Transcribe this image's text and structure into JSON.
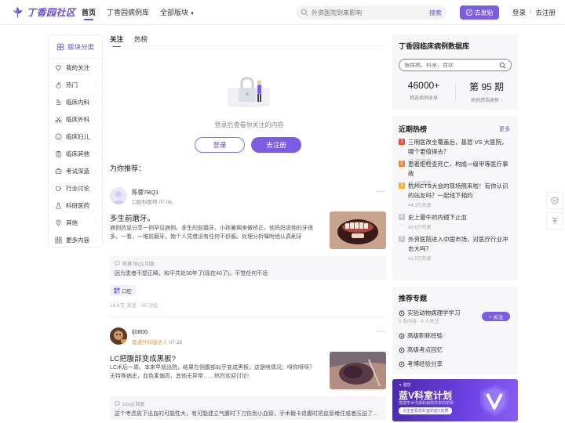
{
  "brand": {
    "logo_text": "丁香园社区",
    "accent": "#7c5ce0"
  },
  "nav": {
    "items": [
      "首页",
      "丁香园病例库",
      "全部版块"
    ]
  },
  "search": {
    "placeholder": "外资医院到来影响",
    "button": "搜索"
  },
  "header": {
    "post_label": "去发贴",
    "login": "登录",
    "sep": "/",
    "register": "去注册"
  },
  "sidebar": {
    "title": "版块分类",
    "items": [
      {
        "label": "我的关注",
        "icon": "heart-icon"
      },
      {
        "label": "热门",
        "icon": "fire-icon"
      },
      {
        "label": "临床内科",
        "icon": "microscope-icon"
      },
      {
        "label": "临床外科",
        "icon": "scissors-icon"
      },
      {
        "label": "临床妇儿",
        "icon": "child-icon"
      },
      {
        "label": "临床其他",
        "icon": "clipboard-icon"
      },
      {
        "label": "考试深造",
        "icon": "briefcase-icon"
      },
      {
        "label": "行业讨论",
        "icon": "coffee-icon"
      },
      {
        "label": "科研医药",
        "icon": "flask-icon"
      },
      {
        "label": "其他",
        "icon": "pin-icon"
      },
      {
        "label": "更多内容",
        "icon": "grid-icon"
      }
    ]
  },
  "tabs": [
    "关注",
    "热榜"
  ],
  "empty": {
    "text": "登录后查看你关注的内容",
    "login": "登录",
    "register": "去注册"
  },
  "recommend_title": "为你推荐：",
  "posts": [
    {
      "user": "陈蓉7BQ1",
      "role": "口腔科医师",
      "date": "07-06",
      "title": "多生前磨牙。",
      "body": "病例信息分享一例罕见病例。多生的前磨牙。小孩暑期来做矫正，他妈妈说他的牙很多。一看，一堆前磨牙。她个人凭借没有任何不舒服。处理分析嘱咐他认真刷牙",
      "reply_user": "陈蓉7BQ1 回复",
      "reply_text": "因为患者不想正畸，和平共处30年了(现在40了)。不觉任何不适",
      "tag": "口腔",
      "stats": "18.6万 浏览 · 25 讨论"
    },
    {
      "user": "lj0806",
      "role": "普通外科版达人",
      "date": "07-23",
      "title": "LC把腹部变成黑板?",
      "body": "LC术后一周。本来早就出院，结果左侧腹部似乎变成黑板，这是啥情况，呀你呀呀？无特殊病史，血色素偏高，其他无异常……热烈欢迎讨论!",
      "reply_user": "zxxsy 回复",
      "reply_text": "这个考虑皮下出血的可能性大，有可能建立气腹时下刀伤到小血管，手术戳卡退腹时把血管堵住或者压迫了..."
    }
  ],
  "database": {
    "title": "丁香园临床病例数据库",
    "search_placeholder": "搜疾病、科室、症状",
    "cases_num": "46000+",
    "cases_label": "精选病例收录",
    "issue_num": "第 95 期",
    "issue_label": "病例感悟更新 ›"
  },
  "hot": {
    "title": "近期热榜",
    "more": "更多",
    "items": [
      {
        "rank": "1",
        "text": "三明医改全覆盖后，基层 VS 大医院，哪个更值得去？",
        "heat": "47.0万热度",
        "color": "#e8503a"
      },
      {
        "rank": "2",
        "text": "患者拒检查死亡，构成一级甲等医疗事故",
        "heat": "45.6万热度",
        "color": "#f0883a"
      },
      {
        "rank": "3",
        "text": "杭州CTS大会的现场照来啦！有你认识的站友吗？一起线下相约",
        "heat": "44.3万热度",
        "color": "#f2b23a"
      },
      {
        "rank": "4",
        "text": "史上最牛的内镜下止血",
        "heat": "43.6万热度",
        "color": "#c8c8cc"
      },
      {
        "rank": "5",
        "text": "外资医院进入中国市场，对医疗行业冲击大吗？",
        "heat": "41.5万热度",
        "color": "#c8c8cc"
      }
    ]
  },
  "topics": {
    "title": "推荐专题",
    "follow": "+ 关注",
    "items": [
      {
        "label": "实验动物病理学学习",
        "sub": "5 条内容 · 6 人关注"
      },
      {
        "label": "高级职称经验"
      },
      {
        "label": "高级考点回忆"
      },
      {
        "label": "考博经验分享"
      }
    ]
  },
  "banner": {
    "tag": "✦ 邀您",
    "title": "蓝V科室计划",
    "sub": "搭建学术沟通和病例共享的桥梁",
    "pill": "点击查看您科室的蓝V资质"
  }
}
